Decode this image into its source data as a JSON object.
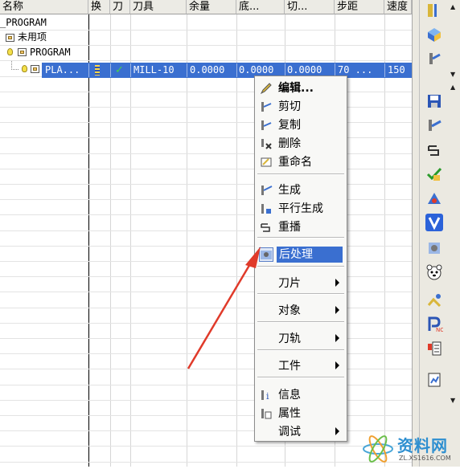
{
  "columns": [
    "名称",
    "换",
    "刀",
    "刀具",
    "余量",
    "底...",
    "切...",
    "步距",
    "速度"
  ],
  "tree": {
    "root": "_PROGRAM",
    "unused": "未用项",
    "program": "PROGRAM",
    "operation": "PLA..."
  },
  "selected_row": {
    "tool": "MILL-10",
    "stock": "0.0000",
    "floor": "0.0000",
    "cut": "0.0000",
    "stepover": "70 ...",
    "speed": "150"
  },
  "context_menu": {
    "items": [
      {
        "label": "编辑...",
        "icon": "edit-icon"
      },
      {
        "label": "剪切",
        "icon": "cut-icon"
      },
      {
        "label": "复制",
        "icon": "copy-icon"
      },
      {
        "label": "删除",
        "icon": "delete-icon"
      },
      {
        "label": "重命名",
        "icon": "rename-icon"
      },
      {
        "label": "生成",
        "icon": "generate-icon"
      },
      {
        "label": "平行生成",
        "icon": "parallel-generate-icon"
      },
      {
        "label": "重播",
        "icon": "replay-icon"
      },
      {
        "label": "后处理",
        "icon": "postprocess-icon"
      },
      {
        "label": "刀片",
        "submenu": true
      },
      {
        "label": "对象",
        "submenu": true
      },
      {
        "label": "刀轨",
        "submenu": true
      },
      {
        "label": "工件",
        "submenu": true
      },
      {
        "label": "信息",
        "icon": "info-icon"
      },
      {
        "label": "属性",
        "icon": "properties-icon"
      },
      {
        "label": "调试",
        "submenu": true
      }
    ]
  },
  "watermark": {
    "text": "资料网",
    "url": "ZL.XS1616.COM"
  },
  "colors": {
    "selection": "#3a6fd0",
    "arrow": "#e03a2a",
    "menu_bg": "#f8f8f6"
  }
}
